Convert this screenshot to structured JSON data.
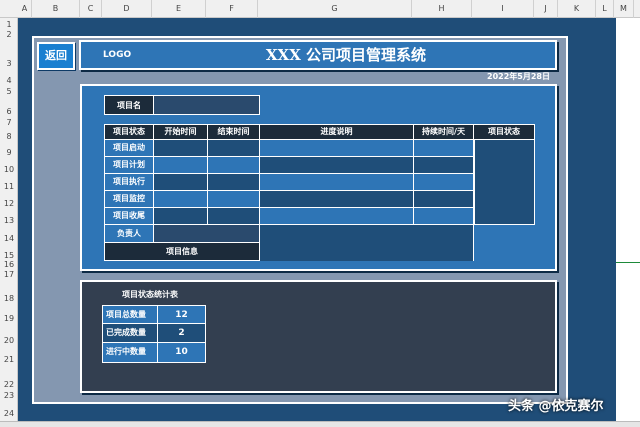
{
  "columns": [
    "A",
    "B",
    "C",
    "D",
    "E",
    "F",
    "G",
    "H",
    "I",
    "J",
    "K",
    "L",
    "M"
  ],
  "rows": [
    "1",
    "2",
    "3",
    "4",
    "5",
    "6",
    "7",
    "8",
    "9",
    "10",
    "11",
    "12",
    "13",
    "14",
    "15",
    "16",
    "17",
    "18",
    "19",
    "20",
    "21",
    "22",
    "23",
    "24"
  ],
  "nav": {
    "back_label": "返回"
  },
  "header": {
    "logo": "LOGO",
    "title": "XXX 公司项目管理系统",
    "date": "2022年5月28日"
  },
  "project": {
    "name_label": "项目名",
    "columns": [
      "项目状态",
      "开始时间",
      "结束时间",
      "进度说明",
      "持续时间/天",
      "项目状态"
    ],
    "statuses": [
      "项目启动",
      "项目计划",
      "项目执行",
      "项目监控",
      "项目收尾"
    ],
    "owner_label": "负责人",
    "info_label": "项目信息"
  },
  "stats": {
    "title": "项目状态统计表",
    "items": [
      {
        "label": "项目总数量",
        "value": "12"
      },
      {
        "label": "已完成数量",
        "value": "2"
      },
      {
        "label": "进行中数量",
        "value": "10"
      }
    ]
  },
  "watermark": "头条 @依克赛尔",
  "colors": {
    "dark_blue": "#1f4e79",
    "mid_blue": "#2e75b6",
    "slate": "#8497b0",
    "panel_dark": "#333f50"
  }
}
